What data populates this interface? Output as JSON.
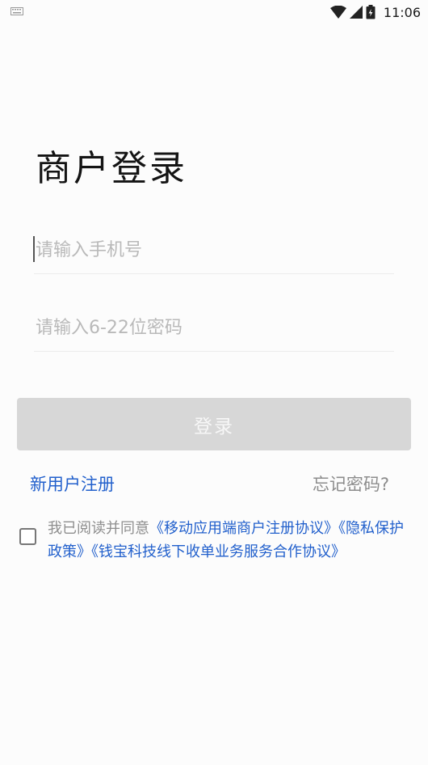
{
  "status_bar": {
    "time": "11:06",
    "icons": [
      "keyboard-icon",
      "wifi-icon",
      "signal-icon",
      "battery-icon"
    ]
  },
  "login": {
    "title": "商户登录",
    "phone_placeholder": "请输入手机号",
    "password_placeholder": "请输入6-22位密码",
    "submit_label": "登录",
    "register_label": "新用户注册",
    "forgot_label": "忘记密码?"
  },
  "agreement": {
    "checked": false,
    "prefix": "我已阅读并同意",
    "links": [
      "《移动应用端商户注册协议》",
      "《隐私保护政策》",
      "《钱宝科技线下收单业务服务合作协议》"
    ]
  },
  "colors": {
    "link": "#2260cc",
    "button_disabled": "#d7d7d7",
    "placeholder": "#b9b9b9"
  }
}
